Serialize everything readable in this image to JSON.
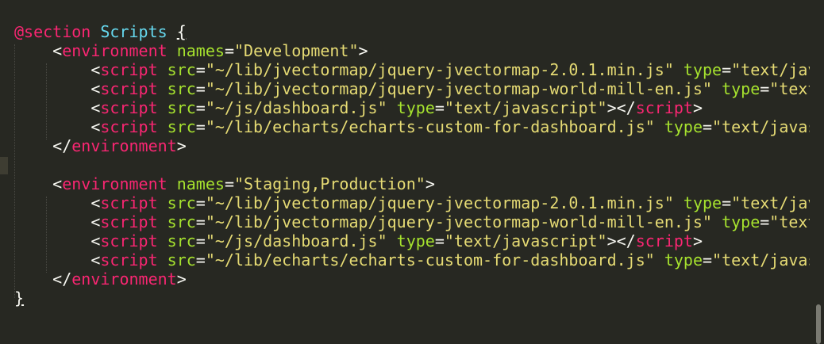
{
  "editor": {
    "theme_colors": {
      "background": "#272822",
      "tag": "#f92672",
      "attribute": "#a6e22e",
      "string": "#e6db74",
      "punctuation": "#f8f8f2",
      "keyword": "#66d9ef"
    }
  },
  "lines": [
    {
      "tokens": [
        {
          "t": "@section",
          "c": "tok-kw-at"
        },
        {
          "t": " ",
          "c": "tok-punct"
        },
        {
          "t": "Scripts",
          "c": "tok-kw-name"
        },
        {
          "t": " ",
          "c": "tok-punct"
        },
        {
          "t": "{",
          "c": "tok-brace"
        }
      ]
    },
    {
      "tokens": [
        {
          "t": "    <",
          "c": "tok-punct"
        },
        {
          "t": "environment",
          "c": "tok-tag"
        },
        {
          "t": " ",
          "c": "tok-punct"
        },
        {
          "t": "names",
          "c": "tok-attr"
        },
        {
          "t": "=",
          "c": "tok-punct"
        },
        {
          "t": "\"Development\"",
          "c": "tok-str"
        },
        {
          "t": ">",
          "c": "tok-punct"
        }
      ]
    },
    {
      "tokens": [
        {
          "t": "        <",
          "c": "tok-punct"
        },
        {
          "t": "script",
          "c": "tok-tag"
        },
        {
          "t": " ",
          "c": "tok-punct"
        },
        {
          "t": "src",
          "c": "tok-attr"
        },
        {
          "t": "=",
          "c": "tok-punct"
        },
        {
          "t": "\"~/lib/jvectormap/jquery-jvectormap-2.0.1.min.js\"",
          "c": "tok-str"
        },
        {
          "t": " ",
          "c": "tok-punct"
        },
        {
          "t": "type",
          "c": "tok-attr"
        },
        {
          "t": "=",
          "c": "tok-punct"
        },
        {
          "t": "\"text/javas",
          "c": "tok-str"
        }
      ]
    },
    {
      "tokens": [
        {
          "t": "        <",
          "c": "tok-punct"
        },
        {
          "t": "script",
          "c": "tok-tag"
        },
        {
          "t": " ",
          "c": "tok-punct"
        },
        {
          "t": "src",
          "c": "tok-attr"
        },
        {
          "t": "=",
          "c": "tok-punct"
        },
        {
          "t": "\"~/lib/jvectormap/jquery-jvectormap-world-mill-en.js\"",
          "c": "tok-str"
        },
        {
          "t": " ",
          "c": "tok-punct"
        },
        {
          "t": "type",
          "c": "tok-attr"
        },
        {
          "t": "=",
          "c": "tok-punct"
        },
        {
          "t": "\"text/ja",
          "c": "tok-str"
        }
      ]
    },
    {
      "tokens": [
        {
          "t": "        <",
          "c": "tok-punct"
        },
        {
          "t": "script",
          "c": "tok-tag"
        },
        {
          "t": " ",
          "c": "tok-punct"
        },
        {
          "t": "src",
          "c": "tok-attr"
        },
        {
          "t": "=",
          "c": "tok-punct"
        },
        {
          "t": "\"~/js/dashboard.js\"",
          "c": "tok-str"
        },
        {
          "t": " ",
          "c": "tok-punct"
        },
        {
          "t": "type",
          "c": "tok-attr"
        },
        {
          "t": "=",
          "c": "tok-punct"
        },
        {
          "t": "\"text/javascript\"",
          "c": "tok-str"
        },
        {
          "t": "></",
          "c": "tok-punct"
        },
        {
          "t": "script",
          "c": "tok-tag"
        },
        {
          "t": ">",
          "c": "tok-punct"
        }
      ]
    },
    {
      "tokens": [
        {
          "t": "        <",
          "c": "tok-punct"
        },
        {
          "t": "script",
          "c": "tok-tag"
        },
        {
          "t": " ",
          "c": "tok-punct"
        },
        {
          "t": "src",
          "c": "tok-attr"
        },
        {
          "t": "=",
          "c": "tok-punct"
        },
        {
          "t": "\"~/lib/echarts/echarts-custom-for-dashboard.js\"",
          "c": "tok-str"
        },
        {
          "t": " ",
          "c": "tok-punct"
        },
        {
          "t": "type",
          "c": "tok-attr"
        },
        {
          "t": "=",
          "c": "tok-punct"
        },
        {
          "t": "\"text/javascr",
          "c": "tok-str"
        }
      ]
    },
    {
      "tokens": [
        {
          "t": "    </",
          "c": "tok-punct"
        },
        {
          "t": "environment",
          "c": "tok-tag"
        },
        {
          "t": ">",
          "c": "tok-punct"
        }
      ]
    },
    {
      "tokens": []
    },
    {
      "tokens": [
        {
          "t": "    <",
          "c": "tok-punct"
        },
        {
          "t": "environment",
          "c": "tok-tag"
        },
        {
          "t": " ",
          "c": "tok-punct"
        },
        {
          "t": "names",
          "c": "tok-attr"
        },
        {
          "t": "=",
          "c": "tok-punct"
        },
        {
          "t": "\"Staging,Production\"",
          "c": "tok-str"
        },
        {
          "t": ">",
          "c": "tok-punct"
        }
      ]
    },
    {
      "tokens": [
        {
          "t": "        <",
          "c": "tok-punct"
        },
        {
          "t": "script",
          "c": "tok-tag"
        },
        {
          "t": " ",
          "c": "tok-punct"
        },
        {
          "t": "src",
          "c": "tok-attr"
        },
        {
          "t": "=",
          "c": "tok-punct"
        },
        {
          "t": "\"~/lib/jvectormap/jquery-jvectormap-2.0.1.min.js\"",
          "c": "tok-str"
        },
        {
          "t": " ",
          "c": "tok-punct"
        },
        {
          "t": "type",
          "c": "tok-attr"
        },
        {
          "t": "=",
          "c": "tok-punct"
        },
        {
          "t": "\"text/javas",
          "c": "tok-str"
        }
      ]
    },
    {
      "tokens": [
        {
          "t": "        <",
          "c": "tok-punct"
        },
        {
          "t": "script",
          "c": "tok-tag"
        },
        {
          "t": " ",
          "c": "tok-punct"
        },
        {
          "t": "src",
          "c": "tok-attr"
        },
        {
          "t": "=",
          "c": "tok-punct"
        },
        {
          "t": "\"~/lib/jvectormap/jquery-jvectormap-world-mill-en.js\"",
          "c": "tok-str"
        },
        {
          "t": " ",
          "c": "tok-punct"
        },
        {
          "t": "type",
          "c": "tok-attr"
        },
        {
          "t": "=",
          "c": "tok-punct"
        },
        {
          "t": "\"text/ja",
          "c": "tok-str"
        }
      ]
    },
    {
      "tokens": [
        {
          "t": "        <",
          "c": "tok-punct"
        },
        {
          "t": "script",
          "c": "tok-tag"
        },
        {
          "t": " ",
          "c": "tok-punct"
        },
        {
          "t": "src",
          "c": "tok-attr"
        },
        {
          "t": "=",
          "c": "tok-punct"
        },
        {
          "t": "\"~/js/dashboard.js\"",
          "c": "tok-str"
        },
        {
          "t": " ",
          "c": "tok-punct"
        },
        {
          "t": "type",
          "c": "tok-attr"
        },
        {
          "t": "=",
          "c": "tok-punct"
        },
        {
          "t": "\"text/javascript\"",
          "c": "tok-str"
        },
        {
          "t": "></",
          "c": "tok-punct"
        },
        {
          "t": "script",
          "c": "tok-tag"
        },
        {
          "t": ">",
          "c": "tok-punct"
        }
      ]
    },
    {
      "tokens": [
        {
          "t": "        <",
          "c": "tok-punct"
        },
        {
          "t": "script",
          "c": "tok-tag"
        },
        {
          "t": " ",
          "c": "tok-punct"
        },
        {
          "t": "src",
          "c": "tok-attr"
        },
        {
          "t": "=",
          "c": "tok-punct"
        },
        {
          "t": "\"~/lib/echarts/echarts-custom-for-dashboard.js\"",
          "c": "tok-str"
        },
        {
          "t": " ",
          "c": "tok-punct"
        },
        {
          "t": "type",
          "c": "tok-attr"
        },
        {
          "t": "=",
          "c": "tok-punct"
        },
        {
          "t": "\"text/javascr",
          "c": "tok-str"
        }
      ]
    },
    {
      "tokens": [
        {
          "t": "    </",
          "c": "tok-punct"
        },
        {
          "t": "environment",
          "c": "tok-tag"
        },
        {
          "t": ">",
          "c": "tok-punct"
        }
      ]
    },
    {
      "tokens": [
        {
          "t": "}",
          "c": "tok-brace"
        }
      ]
    }
  ]
}
